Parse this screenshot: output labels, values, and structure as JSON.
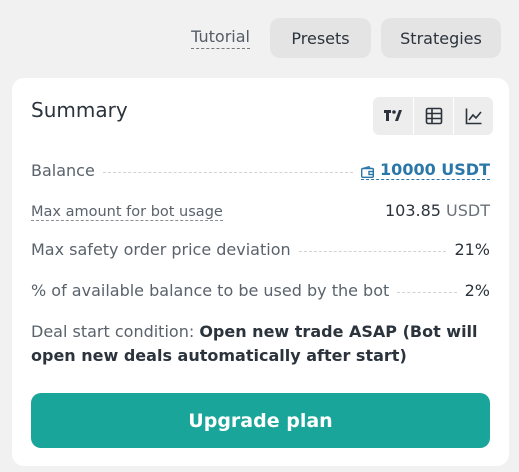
{
  "nav": {
    "tutorial_label": "Tutorial",
    "presets_label": "Presets",
    "strategies_label": "Strategies"
  },
  "summary": {
    "title": "Summary",
    "view_icons": [
      "tradingview-icon",
      "table-icon",
      "line-chart-icon"
    ],
    "rows": [
      {
        "label": "Balance",
        "value": "10000 USDT",
        "value_icon": "wallet-icon"
      },
      {
        "label": "Max amount for bot usage",
        "value": "103.85",
        "unit": "USDT"
      },
      {
        "label": "Max safety order price deviation",
        "value": "21%"
      },
      {
        "label": "% of available balance to be used by the bot",
        "value": "2%"
      }
    ],
    "deal_condition": {
      "prefix": "Deal start condition:",
      "value": "Open new trade ASAP (Bot will open new deals automatically after start)"
    },
    "upgrade_label": "Upgrade plan"
  },
  "colors": {
    "accent": "#1aa59a",
    "link": "#2b78a8",
    "background": "#f1f1f1",
    "card": "#ffffff"
  }
}
